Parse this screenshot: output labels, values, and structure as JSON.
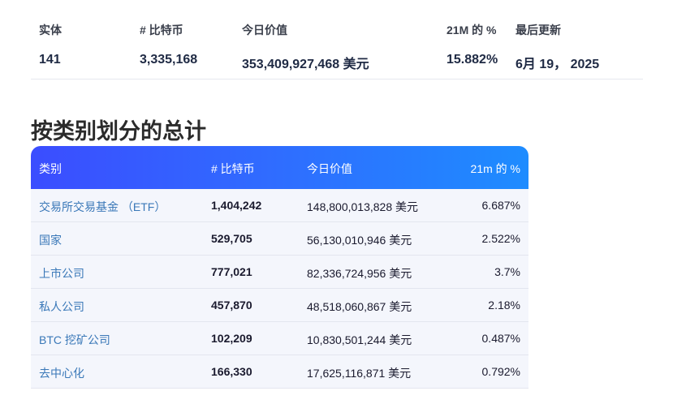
{
  "summary": {
    "headers": [
      "实体",
      "# 比特币",
      "今日价值",
      "21M 的 %",
      "最后更新"
    ],
    "values": [
      "141",
      "3,335,168",
      "353,409,927,468 美元",
      "15.882%",
      "6月 19， 2025"
    ]
  },
  "section_title": "按类别划分的总计",
  "table": {
    "headers": [
      "类别",
      "# 比特币",
      "今日价值",
      "21m 的 %"
    ],
    "rows": [
      {
        "category": "交易所交易基金 （ETF）",
        "btc": "1,404,242",
        "usd": "148,800,013,828 美元",
        "pct": "6.687%"
      },
      {
        "category": "国家",
        "btc": "529,705",
        "usd": "56,130,010,946 美元",
        "pct": "2.522%"
      },
      {
        "category": "上市公司",
        "btc": "777,021",
        "usd": "82,336,724,956 美元",
        "pct": "3.7%"
      },
      {
        "category": "私人公司",
        "btc": "457,870",
        "usd": "48,518,060,867 美元",
        "pct": "2.18%"
      },
      {
        "category": "BTC 挖矿公司",
        "btc": "102,209",
        "usd": "10,830,501,244 美元",
        "pct": "0.487%"
      },
      {
        "category": "去中心化",
        "btc": "166,330",
        "usd": "17,625,116,871 美元",
        "pct": "0.792%"
      }
    ]
  },
  "colors": {
    "header_gradient_start": "#3b4dff",
    "header_gradient_end": "#1e8cff",
    "category_link": "#3a78b8",
    "row_bg": "#f4f6fc"
  }
}
